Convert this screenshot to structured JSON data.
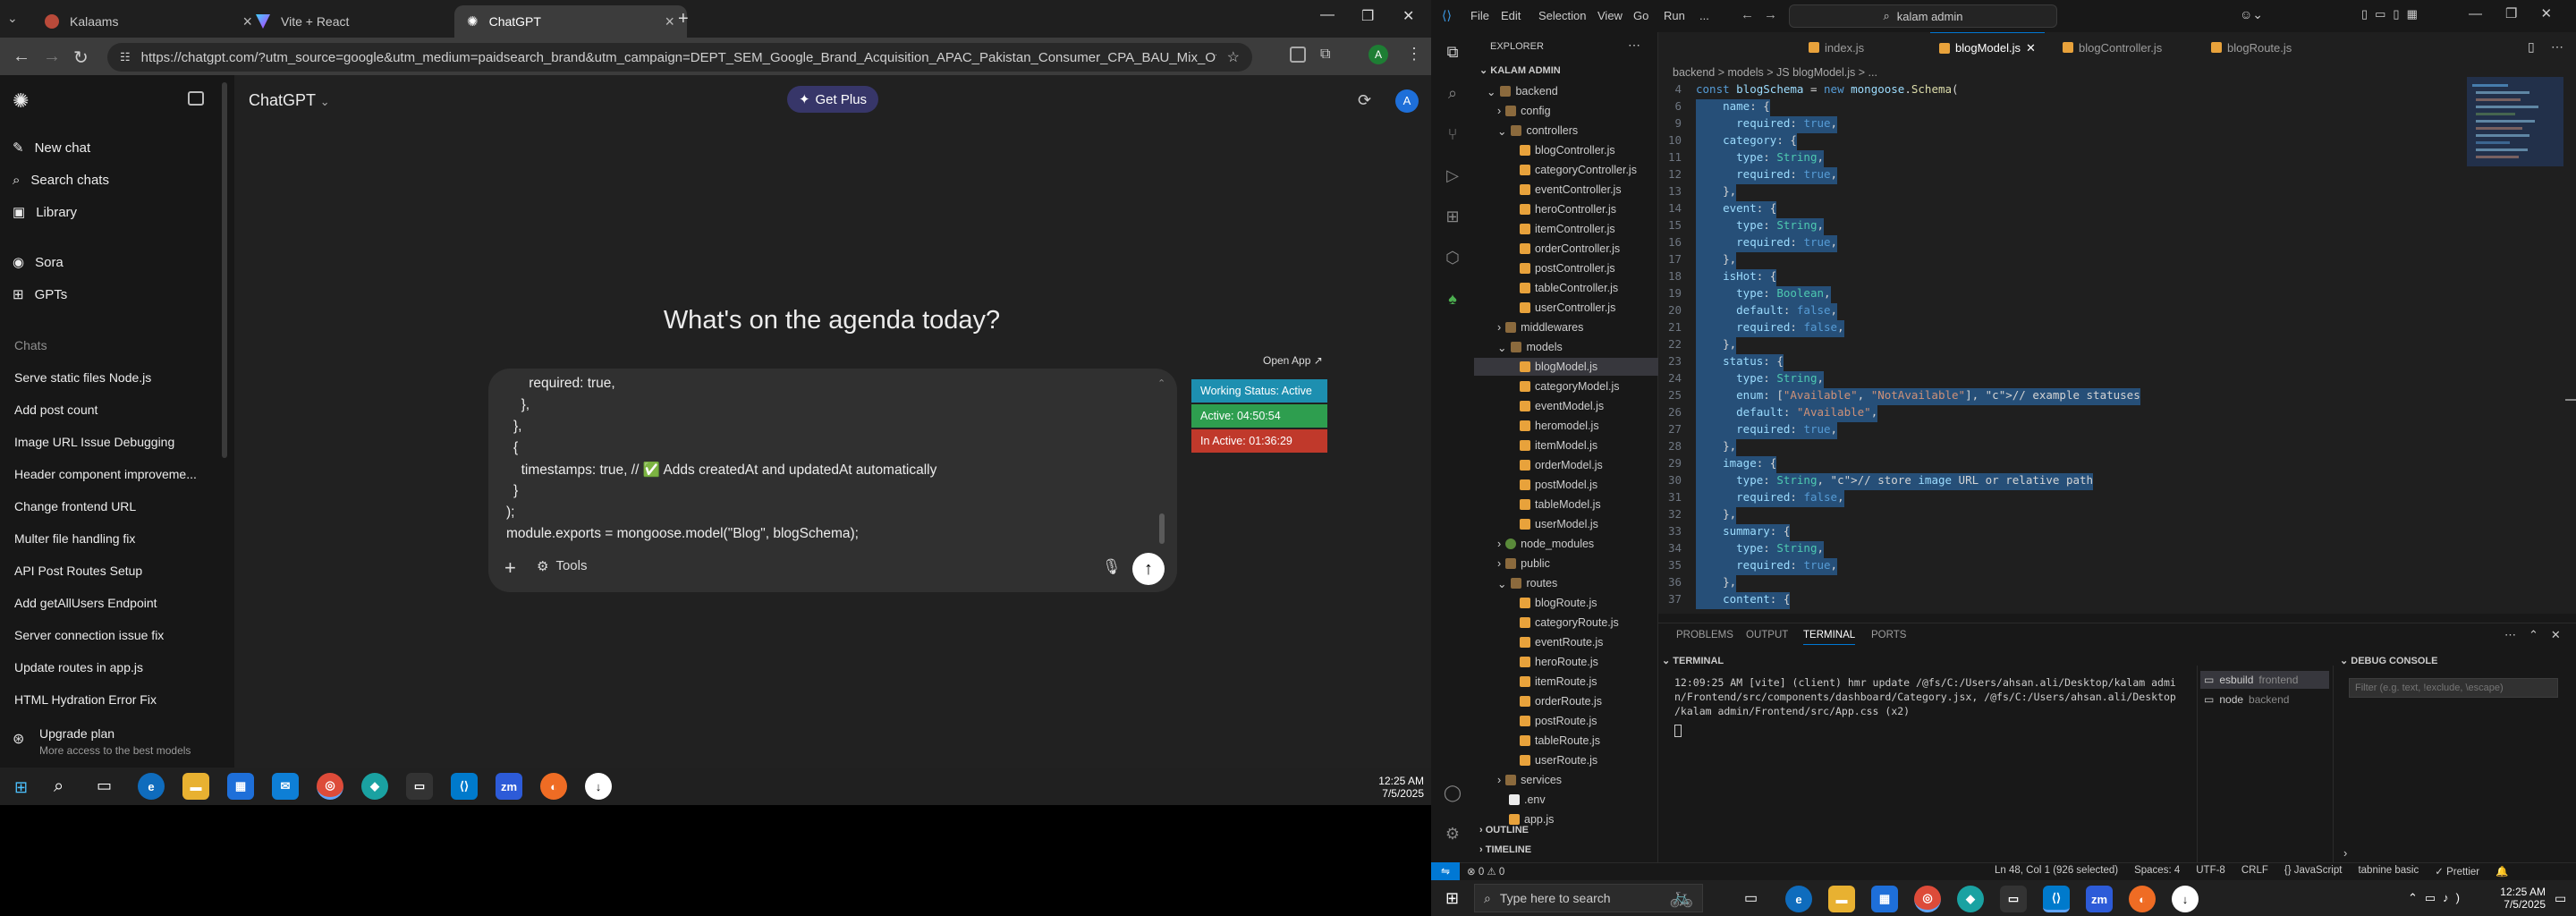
{
  "chrome": {
    "tabs": [
      {
        "title": "Kalaams"
      },
      {
        "title": "Vite + React"
      },
      {
        "title": "ChatGPT"
      }
    ],
    "url": "https://chatgpt.com/?utm_source=google&utm_medium=paidsearch_brand&utm_campaign=DEPT_SEM_Google_Brand_Acquisition_APAC_Pakistan_Consumer_CPA_BAU_Mix_OfficialEnglish_HighRi...",
    "profile_letter": "A"
  },
  "chatgpt": {
    "nav": {
      "new_chat": "New chat",
      "search": "Search chats",
      "library": "Library",
      "sora": "Sora",
      "gpts": "GPTs"
    },
    "chats_heading": "Chats",
    "chats": [
      "Serve static files Node.js",
      "Add post count",
      "Image URL Issue Debugging",
      "Header component improveme...",
      "Change frontend URL",
      "Multer file handling fix",
      "API Post Routes Setup",
      "Add getAllUsers Endpoint",
      "Server connection issue fix",
      "Update routes in app.js",
      "HTML Hydration Error Fix"
    ],
    "upgrade": {
      "title": "Upgrade plan",
      "subtitle": "More access to the best models"
    },
    "model_title": "ChatGPT",
    "get_plus": "Get Plus",
    "avatar": "A",
    "greeting": "What's on the agenda today?",
    "composer_lines": [
      "    required: true,",
      "  },",
      "},",
      "{",
      "  timestamps: true, // ✅ Adds createdAt and updatedAt automatically",
      "}",
      ");",
      "module.exports = mongoose.model(\"Blog\", blogSchema);"
    ],
    "tools": "Tools"
  },
  "status_widget": {
    "open_app": "Open App ↗",
    "working": "Working Status: Active",
    "active": "Active: 04:50:54",
    "inactive": "In Active: 01:36:29",
    "colors": {
      "working": "#1d8fb0",
      "active": "#2e9e4f",
      "inactive": "#c0392b"
    }
  },
  "taskbar_left": {
    "time": "12:25 AM",
    "date": "7/5/2025"
  },
  "vscode": {
    "menu": [
      "File",
      "Edit",
      "Selection",
      "View",
      "Go",
      "Run",
      "..."
    ],
    "search": "kalam admin",
    "explorer_title": "EXPLORER",
    "workspace": "KALAM ADMIN",
    "tree": [
      {
        "label": "backend",
        "type": "folder-open",
        "indent": 1
      },
      {
        "label": "config",
        "type": "folder",
        "indent": 2
      },
      {
        "label": "controllers",
        "type": "folder-open",
        "indent": 2
      },
      {
        "label": "blogController.js",
        "type": "js",
        "indent": 3
      },
      {
        "label": "categoryController.js",
        "type": "js",
        "indent": 3
      },
      {
        "label": "eventController.js",
        "type": "js",
        "indent": 3
      },
      {
        "label": "heroController.js",
        "type": "js",
        "indent": 3
      },
      {
        "label": "itemController.js",
        "type": "js",
        "indent": 3
      },
      {
        "label": "orderController.js",
        "type": "js",
        "indent": 3
      },
      {
        "label": "postController.js",
        "type": "js",
        "indent": 3
      },
      {
        "label": "tableController.js",
        "type": "js",
        "indent": 3
      },
      {
        "label": "userController.js",
        "type": "js",
        "indent": 3
      },
      {
        "label": "middlewares",
        "type": "folder",
        "indent": 2
      },
      {
        "label": "models",
        "type": "folder-open",
        "indent": 2
      },
      {
        "label": "blogModel.js",
        "type": "js",
        "indent": 3,
        "selected": true
      },
      {
        "label": "categoryModel.js",
        "type": "js",
        "indent": 3
      },
      {
        "label": "eventModel.js",
        "type": "js",
        "indent": 3
      },
      {
        "label": "heromodel.js",
        "type": "js",
        "indent": 3
      },
      {
        "label": "itemModel.js",
        "type": "js",
        "indent": 3
      },
      {
        "label": "orderModel.js",
        "type": "js",
        "indent": 3
      },
      {
        "label": "postModel.js",
        "type": "js",
        "indent": 3
      },
      {
        "label": "tableModel.js",
        "type": "js",
        "indent": 3
      },
      {
        "label": "userModel.js",
        "type": "js",
        "indent": 3
      },
      {
        "label": "node_modules",
        "type": "folder-green",
        "indent": 2
      },
      {
        "label": "public",
        "type": "folder",
        "indent": 2
      },
      {
        "label": "routes",
        "type": "folder-open",
        "indent": 2
      },
      {
        "label": "blogRoute.js",
        "type": "js",
        "indent": 3
      },
      {
        "label": "categoryRoute.js",
        "type": "js",
        "indent": 3
      },
      {
        "label": "eventRoute.js",
        "type": "js",
        "indent": 3
      },
      {
        "label": "heroRoute.js",
        "type": "js",
        "indent": 3
      },
      {
        "label": "itemRoute.js",
        "type": "js",
        "indent": 3
      },
      {
        "label": "orderRoute.js",
        "type": "js",
        "indent": 3
      },
      {
        "label": "postRoute.js",
        "type": "js",
        "indent": 3
      },
      {
        "label": "tableRoute.js",
        "type": "js",
        "indent": 3
      },
      {
        "label": "userRoute.js",
        "type": "js",
        "indent": 3
      },
      {
        "label": "services",
        "type": "folder",
        "indent": 2
      },
      {
        "label": ".env",
        "type": "env",
        "indent": 2
      },
      {
        "label": "app.js",
        "type": "js",
        "indent": 2
      }
    ],
    "outline": "OUTLINE",
    "timeline": "TIMELINE",
    "editor_tabs": [
      {
        "label": "index.js",
        "active": false
      },
      {
        "label": "blogModel.js",
        "active": true
      },
      {
        "label": "blogController.js",
        "active": false
      },
      {
        "label": "blogRoute.js",
        "active": false
      }
    ],
    "breadcrumb": "backend > models > JS blogModel.js > ...",
    "code": [
      {
        "n": "4",
        "t": "const blogSchema = new mongoose.Schema("
      },
      {
        "n": "6",
        "t": "    name: {"
      },
      {
        "n": "9",
        "t": "      required: true,"
      },
      {
        "n": "10",
        "t": "    category: {"
      },
      {
        "n": "11",
        "t": "      type: String,"
      },
      {
        "n": "12",
        "t": "      required: true,"
      },
      {
        "n": "13",
        "t": "    },"
      },
      {
        "n": "14",
        "t": "    event: {"
      },
      {
        "n": "15",
        "t": "      type: String,"
      },
      {
        "n": "16",
        "t": "      required: true,"
      },
      {
        "n": "17",
        "t": "    },"
      },
      {
        "n": "18",
        "t": "    isHot: {"
      },
      {
        "n": "19",
        "t": "      type: Boolean,"
      },
      {
        "n": "20",
        "t": "      default: false,"
      },
      {
        "n": "21",
        "t": "      required: false,"
      },
      {
        "n": "22",
        "t": "    },"
      },
      {
        "n": "23",
        "t": "    status: {"
      },
      {
        "n": "24",
        "t": "      type: String,"
      },
      {
        "n": "25",
        "t": "      enum: [\"Available\", \"NotAvailable\"], // example statuses"
      },
      {
        "n": "26",
        "t": "      default: \"Available\","
      },
      {
        "n": "27",
        "t": "      required: true,"
      },
      {
        "n": "28",
        "t": "    },"
      },
      {
        "n": "29",
        "t": "    image: {"
      },
      {
        "n": "30",
        "t": "      type: String, // store image URL or relative path"
      },
      {
        "n": "31",
        "t": "      required: false,"
      },
      {
        "n": "32",
        "t": "    },"
      },
      {
        "n": "33",
        "t": "    summary: {"
      },
      {
        "n": "34",
        "t": "      type: String,"
      },
      {
        "n": "35",
        "t": "      required: true,"
      },
      {
        "n": "36",
        "t": "    },"
      },
      {
        "n": "37",
        "t": "    content: {"
      }
    ],
    "panel_tabs": [
      "PROBLEMS",
      "OUTPUT",
      "TERMINAL",
      "PORTS"
    ],
    "terminal_title": "TERMINAL",
    "terminal_lines": [
      "12:09:25 AM [vite] (client) hmr update /@fs/C:/Users/ahsan.ali/Desktop/kalam admi",
      "n/Frontend/src/components/dashboard/Category.jsx, /@fs/C:/Users/ahsan.ali/Desktop",
      "/kalam admin/Frontend/src/App.css (x2)"
    ],
    "terminals": [
      {
        "name": "esbuild",
        "desc": "frontend"
      },
      {
        "name": "node",
        "desc": "backend"
      }
    ],
    "debug_title": "DEBUG CONSOLE",
    "debug_filter_placeholder": "Filter (e.g. text, !exclude, \\escape)",
    "status": {
      "errors": "⊗ 0 ⚠ 0",
      "warnings": "⚠ 0",
      "cursor": "Ln 48, Col 1 (926 selected)",
      "spaces": "Spaces: 4",
      "encoding": "UTF-8",
      "eol": "CRLF",
      "lang": "{} JavaScript",
      "tabnine": "tabnine basic",
      "prettier": "✓ Prettier"
    }
  },
  "taskbar_right": {
    "search_placeholder": "Type here to search",
    "time": "12:25 AM",
    "date": "7/5/2025"
  }
}
